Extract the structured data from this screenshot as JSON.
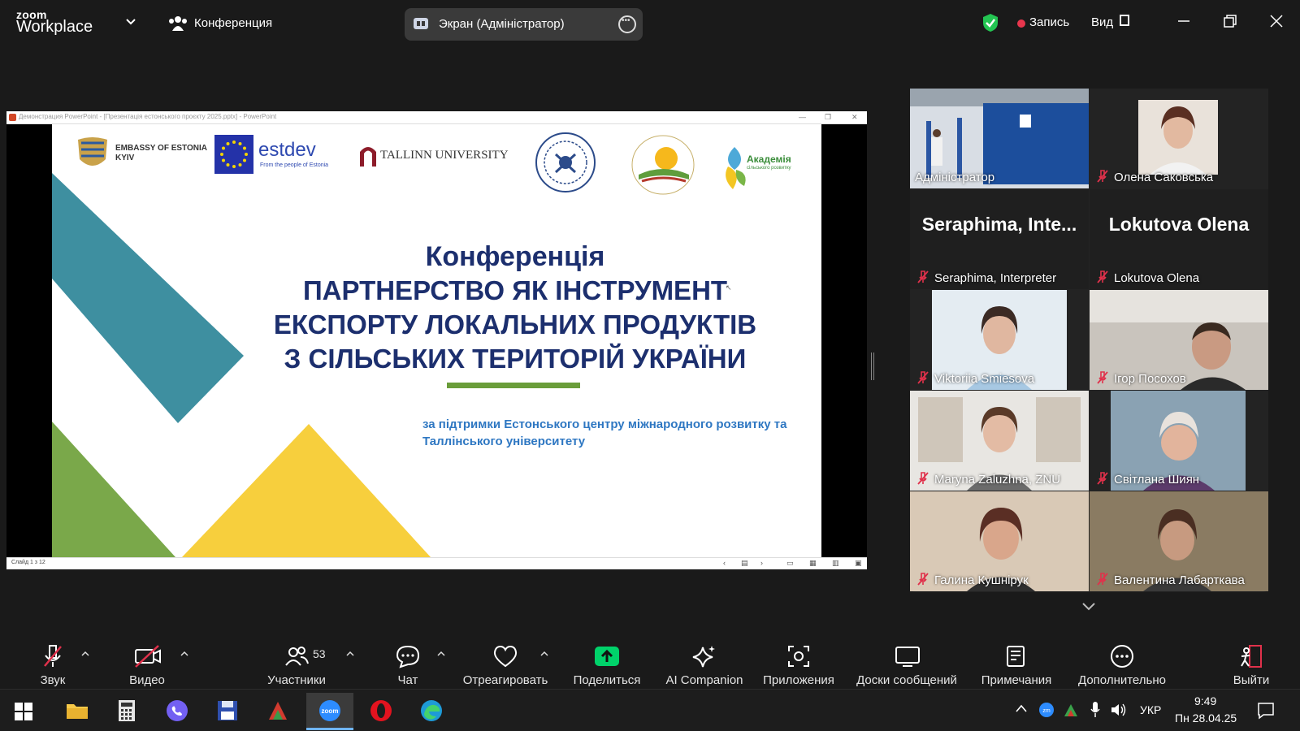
{
  "titlebar": {
    "brand_top": "zoom",
    "brand_bottom": "Workplace",
    "meeting_name": "Конференция",
    "screen_source": "Экран (Адміністратор)",
    "record_label": "Запись",
    "view_label": "Вид"
  },
  "ppt": {
    "window_title": "Демонстрация PowerPoint - [Презентація естонського проєкту 2025.pptx] - PowerPoint",
    "status": "Слайд 1 з 12",
    "slide": {
      "logo_embassy_1": "EMBASSY OF ESTONIA",
      "logo_embassy_2": "KYIV",
      "logo_estdev": "estdev",
      "logo_estdev_sub": "From the people of Estonia",
      "logo_tallinn": "TALLINN UNIVERSITY",
      "logo_academy": "Академія",
      "logo_academy_sub": "сільського розвитку",
      "title_1": "Конференція",
      "title_2": "ПАРТНЕРСТВО ЯК ІНСТРУМЕНТ",
      "title_3": "ЕКСПОРТУ ЛОКАЛЬНИХ ПРОДУКТІВ",
      "title_4": "З СІЛЬСЬКИХ ТЕРИТОРІЙ УКРАЇНИ",
      "subtitle": "за підтримки Естонського центру міжнародного розвитку та Таллінського університету"
    }
  },
  "gallery": {
    "tiles": [
      {
        "name": "Адміністратор",
        "muted": false,
        "active": true
      },
      {
        "name": "Олена Саковська",
        "muted": true
      },
      {
        "name": "Seraphima, Interpreter",
        "big": "Seraphima,  Inte...",
        "muted": true
      },
      {
        "name": "Lokutova Olena",
        "big": "Lokutova Olena",
        "muted": true
      },
      {
        "name": "Viktoriia Smiesova",
        "muted": true
      },
      {
        "name": "Ігор Посохов",
        "muted": true
      },
      {
        "name": "Maryna Zaluzhna, ZNU",
        "muted": true
      },
      {
        "name": "Світлана Шиян",
        "muted": true
      },
      {
        "name": "Галина Кушнірук",
        "muted": true
      },
      {
        "name": "Валентина Лабарткава",
        "muted": true
      }
    ]
  },
  "toolbar": {
    "audio": "Звук",
    "video": "Видео",
    "participants": "Участники",
    "participants_count": "53",
    "chat": "Чат",
    "react": "Отреагировать",
    "share": "Поделиться",
    "ai": "AI Companion",
    "apps": "Приложения",
    "boards": "Доски сообщений",
    "notes": "Примечания",
    "more": "Дополнительно",
    "leave": "Выйти"
  },
  "taskbar": {
    "lang": "УКР",
    "time": "9:49",
    "date": "Пн 28.04.25"
  },
  "colors": {
    "active_border": "#2ecc71",
    "record": "#e8364d",
    "share_green": "#00d26a",
    "title_blue": "#1c2f6e",
    "subtitle_blue": "#2e77c2"
  }
}
